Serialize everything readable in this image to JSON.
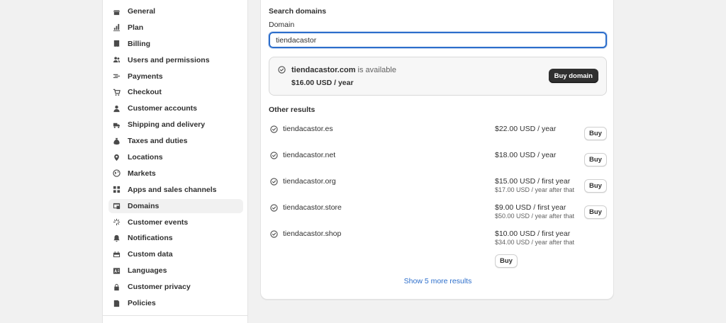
{
  "sidebar": {
    "items": [
      {
        "label": "General",
        "icon": "store-icon"
      },
      {
        "label": "Plan",
        "icon": "chart-icon"
      },
      {
        "label": "Billing",
        "icon": "receipt-icon"
      },
      {
        "label": "Users and permissions",
        "icon": "users-icon"
      },
      {
        "label": "Payments",
        "icon": "payments-icon"
      },
      {
        "label": "Checkout",
        "icon": "cart-icon"
      },
      {
        "label": "Customer accounts",
        "icon": "person-icon"
      },
      {
        "label": "Shipping and delivery",
        "icon": "truck-icon"
      },
      {
        "label": "Taxes and duties",
        "icon": "money-bag-icon"
      },
      {
        "label": "Locations",
        "icon": "location-pin-icon"
      },
      {
        "label": "Markets",
        "icon": "globe-icon"
      },
      {
        "label": "Apps and sales channels",
        "icon": "apps-icon"
      },
      {
        "label": "Domains",
        "icon": "domain-icon",
        "active": true
      },
      {
        "label": "Customer events",
        "icon": "sparkle-icon"
      },
      {
        "label": "Notifications",
        "icon": "bell-icon"
      },
      {
        "label": "Custom data",
        "icon": "custom-data-icon"
      },
      {
        "label": "Languages",
        "icon": "language-icon"
      },
      {
        "label": "Customer privacy",
        "icon": "lock-icon"
      },
      {
        "label": "Policies",
        "icon": "policy-icon"
      }
    ]
  },
  "search": {
    "title": "Search domains",
    "field_label": "Domain",
    "value": "tiendacastor"
  },
  "available": {
    "domain": "tiendacastor.com",
    "status": "is available",
    "price": "$16.00 USD / year",
    "button": "Buy domain"
  },
  "other": {
    "title": "Other results",
    "results": [
      {
        "domain": "tiendacastor.es",
        "price": "$22.00 USD / year",
        "sub": "",
        "button": "Buy"
      },
      {
        "domain": "tiendacastor.net",
        "price": "$18.00 USD / year",
        "sub": "",
        "button": "Buy"
      },
      {
        "domain": "tiendacastor.org",
        "price": "$15.00 USD / first year",
        "sub": "$17.00 USD / year after that",
        "button": "Buy"
      },
      {
        "domain": "tiendacastor.store",
        "price": "$9.00 USD / first year",
        "sub": "$50.00 USD / year after that",
        "button": "Buy"
      },
      {
        "domain": "tiendacastor.shop",
        "price": "$10.00 USD / first year",
        "sub": "$34.00 USD / year after that",
        "button": "Buy"
      }
    ],
    "show_more": "Show 5 more results"
  },
  "colors": {
    "accent": "#2c6ecb",
    "primary_button": "#303030",
    "active_bg": "#f1f1f1"
  }
}
